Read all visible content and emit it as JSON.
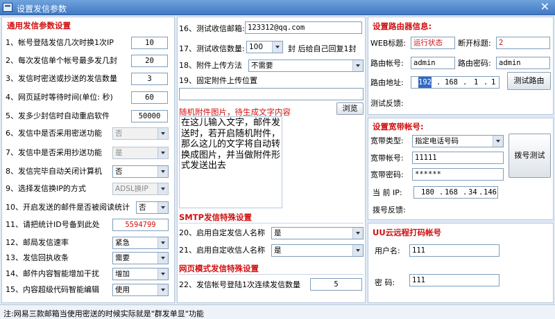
{
  "window": {
    "title": "设置发信参数",
    "close": "✕"
  },
  "left": {
    "section": "通用发信参数设置",
    "rows": [
      {
        "label": "1、帐号登陆发信几次时换1次IP",
        "value": "10"
      },
      {
        "label": "2、每次发信单个帐号最多发几封",
        "value": "20"
      },
      {
        "label": "3、发信时密送或抄送的发信数量",
        "value": "3"
      },
      {
        "label": "4、网页延时等待时间(单位: 秒)",
        "value": "60"
      },
      {
        "label": "5、发多少封信时自动重启软件",
        "value": "50000"
      },
      {
        "label": "6、发信中是否采用密送功能",
        "value": "否"
      },
      {
        "label": "7、发信中是否采用抄送功能",
        "value": "是"
      },
      {
        "label": "8、发信完毕自动关闭计算机",
        "value": "否"
      },
      {
        "label": "9、选择发信换IP的方式",
        "value": "ADSL换IP"
      },
      {
        "label": "10、开启发送的邮件是否被阅读统计",
        "value": "否"
      },
      {
        "label": "11、请把统计ID号备到此处",
        "value": "5594799"
      },
      {
        "label": "12、邮局发信速率",
        "value": "紧急"
      },
      {
        "label": "13、发信回执收条",
        "value": "需要"
      },
      {
        "label": "14、邮件内容智能增加干扰",
        "value": "增加"
      },
      {
        "label": "15、内容超级代码智能编辑",
        "value": "使用"
      }
    ]
  },
  "middle": {
    "r16": {
      "label": "16、测试收信邮箱:",
      "value": "123312@qq.com"
    },
    "r17": {
      "label": "17、测试收信数量:",
      "value": "100",
      "suffix": "封 后给自己回复1封"
    },
    "r18": {
      "label": "18、附件上传方法",
      "value": "不需要"
    },
    "r19": {
      "label": "19、固定附件上传位置",
      "value": ""
    },
    "random_label": "随机附件图片，待生成文字内容",
    "browse": "浏览",
    "random_text": "在这儿输入文字，邮件发送时，若开启随机附件，那么这儿的文字将自动转换成图片，并当做附件形式发送出去",
    "smtp_section": "SMTP发信特殊设置",
    "r20": {
      "label": "20、启用自定发信人名称",
      "value": "是"
    },
    "r21": {
      "label": "21、启用自定收信人名称",
      "value": "是"
    },
    "web_section": "网页模式发信特殊设置",
    "r22": {
      "label": "22、发信帐号登陆1次连续发信数量",
      "value": "5"
    }
  },
  "router": {
    "section": "设置路由器信息:",
    "web_title_label": "WEB标题:",
    "web_title": "运行状态",
    "disconnect_label": "断开标题:",
    "disconnect": "2",
    "account_label": "路由帐号:",
    "account": "admin",
    "password_label": "路由密码:",
    "password": "admin",
    "address_label": "路由地址:",
    "ip": [
      "192",
      ".",
      "168",
      ".",
      "1",
      ".",
      "1"
    ],
    "test_button": "测试路由",
    "feedback_label": "测试反馈:"
  },
  "broadband": {
    "section": "设置宽带帐号:",
    "type_label": "宽带类型:",
    "type": "指定电话号码",
    "account_label": "宽带帐号:",
    "account": "11111",
    "password_label": "宽带密码:",
    "password": "******",
    "ip_label": "当 前 IP:",
    "ip": [
      "180",
      ".",
      "168",
      ".",
      "34",
      ".",
      "146"
    ],
    "dial_button": "拨号测试",
    "feedback_label": "拨号反馈:"
  },
  "uu": {
    "section": "UU云远程打码帐号",
    "user_label": "用户名:",
    "user": "111",
    "pass_label": "密  码:",
    "pass": "111"
  },
  "status": "注:网易三款邮箱当使用密送的时候实际就是\"群发单显\"功能"
}
